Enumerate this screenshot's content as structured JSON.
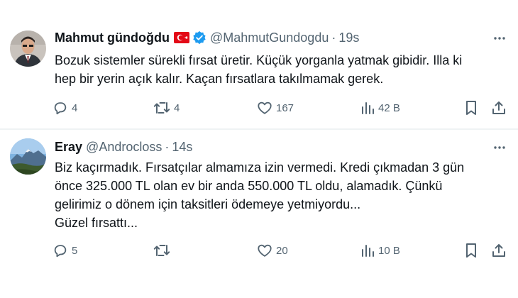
{
  "tweets": [
    {
      "name": "Mahmut gündoğdu",
      "flag_icon": "turkey-flag-icon",
      "verified": true,
      "handle": "@MahmutGundogdu",
      "separator": "·",
      "time": "19s",
      "text_lines": [
        "Bozuk sistemler sürekli fırsat üretir.  Küçük yorganla yatmak gibidir. Illa ki",
        "hep bir yerin açık kalır.  Kaçan fırsatlara takılmamak gerek."
      ],
      "replies": "4",
      "retweets": "4",
      "likes": "167",
      "views": "42 B"
    },
    {
      "name": "Eray",
      "handle": "@Androcloss",
      "separator": "·",
      "time": "14s",
      "text_lines": [
        "Biz kaçırmadık. Fırsatçılar almamıza izin vermedi. Kredi çıkmadan 3 gün",
        "önce 325.000 TL olan ev bir anda 550.000 TL oldu, alamadık. Çünkü",
        "gelirimiz o dönem için taksitleri ödemeye yetmiyordu...",
        "Güzel fırsattı..."
      ],
      "replies": "5",
      "retweets": "",
      "likes": "20",
      "views": "10 B"
    }
  ],
  "colors": {
    "text": "#0f1419",
    "secondary": "#536471",
    "verified_blue": "#1d9bf0",
    "flag_red": "#e30a17",
    "divider": "#eff3f4"
  }
}
